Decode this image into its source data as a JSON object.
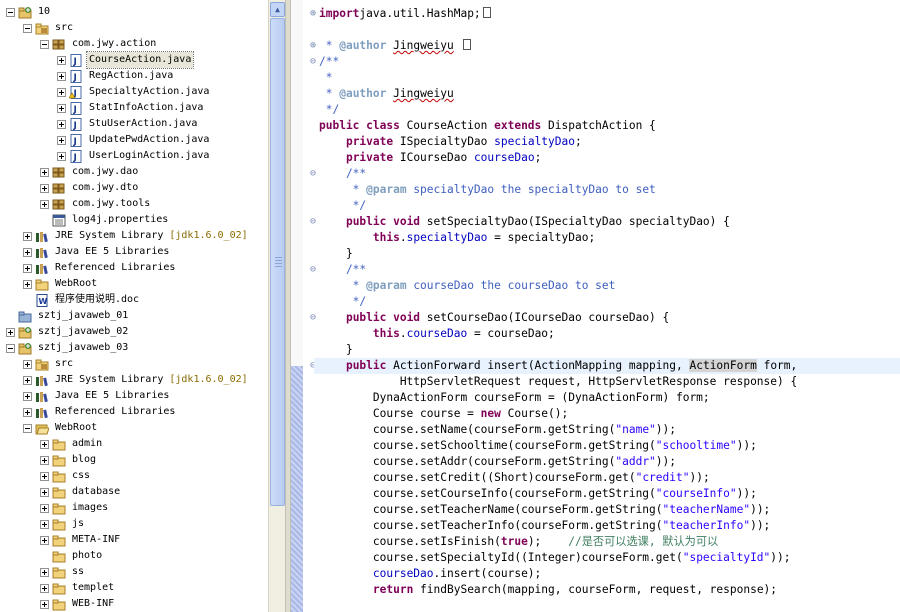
{
  "explorer": {
    "rows": [
      {
        "id": "r0",
        "indent": 0,
        "toggle": "minus",
        "icon": "project-icon",
        "label": "10"
      },
      {
        "id": "r1",
        "indent": 1,
        "toggle": "minus",
        "icon": "source-folder-icon",
        "label": "src"
      },
      {
        "id": "r2",
        "indent": 2,
        "toggle": "minus",
        "icon": "package-icon",
        "label": "com.jwy.action"
      },
      {
        "id": "r3",
        "indent": 3,
        "toggle": "plus",
        "icon": "java-file-icon",
        "label": "CourseAction.java",
        "selected": true
      },
      {
        "id": "r4",
        "indent": 3,
        "toggle": "plus",
        "icon": "java-file-icon",
        "label": "RegAction.java"
      },
      {
        "id": "r5",
        "indent": 3,
        "toggle": "plus",
        "icon": "java-file-warning-icon",
        "label": "SpecialtyAction.java"
      },
      {
        "id": "r6",
        "indent": 3,
        "toggle": "plus",
        "icon": "java-file-icon",
        "label": "StatInfoAction.java"
      },
      {
        "id": "r7",
        "indent": 3,
        "toggle": "plus",
        "icon": "java-file-icon",
        "label": "StuUserAction.java"
      },
      {
        "id": "r8",
        "indent": 3,
        "toggle": "plus",
        "icon": "java-file-icon",
        "label": "UpdatePwdAction.java"
      },
      {
        "id": "r9",
        "indent": 3,
        "toggle": "plus",
        "icon": "java-file-icon",
        "label": "UserLoginAction.java"
      },
      {
        "id": "r10",
        "indent": 2,
        "toggle": "plus",
        "icon": "package-icon",
        "label": "com.jwy.dao"
      },
      {
        "id": "r11",
        "indent": 2,
        "toggle": "plus",
        "icon": "package-icon",
        "label": "com.jwy.dto"
      },
      {
        "id": "r12",
        "indent": 2,
        "toggle": "plus",
        "icon": "package-icon",
        "label": "com.jwy.tools"
      },
      {
        "id": "r13",
        "indent": 2,
        "toggle": "none",
        "icon": "properties-file-icon",
        "label": "log4j.properties"
      },
      {
        "id": "r14",
        "indent": 1,
        "toggle": "plus",
        "icon": "library-icon",
        "label": "JRE System Library",
        "deco": "[jdk1.6.0_02]"
      },
      {
        "id": "r15",
        "indent": 1,
        "toggle": "plus",
        "icon": "library-icon",
        "label": "Java EE 5 Libraries"
      },
      {
        "id": "r16",
        "indent": 1,
        "toggle": "plus",
        "icon": "library-icon",
        "label": "Referenced Libraries"
      },
      {
        "id": "r17",
        "indent": 1,
        "toggle": "plus",
        "icon": "folder-icon",
        "label": "WebRoot"
      },
      {
        "id": "r18",
        "indent": 1,
        "toggle": "none",
        "icon": "doc-file-icon",
        "label": "程序使用说明.doc"
      },
      {
        "id": "r19",
        "indent": 0,
        "toggle": "none",
        "icon": "project-closed-icon",
        "label": "sztj_javaweb_01"
      },
      {
        "id": "r20",
        "indent": 0,
        "toggle": "plus",
        "icon": "project-icon",
        "label": "sztj_javaweb_02"
      },
      {
        "id": "r21",
        "indent": 0,
        "toggle": "minus",
        "icon": "project-icon",
        "label": "sztj_javaweb_03"
      },
      {
        "id": "r22",
        "indent": 1,
        "toggle": "plus",
        "icon": "source-folder-icon",
        "label": "src"
      },
      {
        "id": "r23",
        "indent": 1,
        "toggle": "plus",
        "icon": "library-icon",
        "label": "JRE System Library",
        "deco": "[jdk1.6.0_02]"
      },
      {
        "id": "r24",
        "indent": 1,
        "toggle": "plus",
        "icon": "library-icon",
        "label": "Java EE 5 Libraries"
      },
      {
        "id": "r25",
        "indent": 1,
        "toggle": "plus",
        "icon": "library-icon",
        "label": "Referenced Libraries"
      },
      {
        "id": "r26",
        "indent": 1,
        "toggle": "minus",
        "icon": "folder-open-icon",
        "label": "WebRoot"
      },
      {
        "id": "r27",
        "indent": 2,
        "toggle": "plus",
        "icon": "folder-icon",
        "label": "admin"
      },
      {
        "id": "r28",
        "indent": 2,
        "toggle": "plus",
        "icon": "folder-icon",
        "label": "blog"
      },
      {
        "id": "r29",
        "indent": 2,
        "toggle": "plus",
        "icon": "folder-icon",
        "label": "css"
      },
      {
        "id": "r30",
        "indent": 2,
        "toggle": "plus",
        "icon": "folder-icon",
        "label": "database"
      },
      {
        "id": "r31",
        "indent": 2,
        "toggle": "plus",
        "icon": "folder-icon",
        "label": "images"
      },
      {
        "id": "r32",
        "indent": 2,
        "toggle": "plus",
        "icon": "folder-icon",
        "label": "js"
      },
      {
        "id": "r33",
        "indent": 2,
        "toggle": "plus",
        "icon": "folder-icon",
        "label": "META-INF"
      },
      {
        "id": "r34",
        "indent": 2,
        "toggle": "none",
        "icon": "folder-icon",
        "label": "photo"
      },
      {
        "id": "r35",
        "indent": 2,
        "toggle": "plus",
        "icon": "folder-icon",
        "label": "ss"
      },
      {
        "id": "r36",
        "indent": 2,
        "toggle": "plus",
        "icon": "folder-icon",
        "label": "templet"
      },
      {
        "id": "r37",
        "indent": 2,
        "toggle": "plus",
        "icon": "folder-icon",
        "label": "WEB-INF"
      }
    ],
    "scroll_up_icon": "scroll-up-arrow-icon"
  },
  "editor": {
    "lines": [
      {
        "fold": "plus",
        "tokens": [
          [
            "k",
            "import"
          ],
          [
            "",
            "java.util.HashMap;"
          ],
          [
            "box",
            ""
          ]
        ]
      },
      {
        "fold": "",
        "tokens": []
      },
      {
        "fold": "plus",
        "tokens": [
          [
            "cm",
            " * "
          ],
          [
            "tag",
            "@author"
          ],
          [
            "cm",
            " "
          ],
          [
            "sq",
            "Jingweiyu"
          ],
          [
            "cm",
            " "
          ],
          [
            "box",
            ""
          ]
        ]
      },
      {
        "fold": "minus",
        "tokens": [
          [
            "cm",
            "/**"
          ]
        ]
      },
      {
        "fold": "",
        "tokens": [
          [
            "cm",
            " *"
          ]
        ]
      },
      {
        "fold": "",
        "tokens": [
          [
            "cm",
            " * "
          ],
          [
            "tag",
            "@author"
          ],
          [
            "cm",
            " "
          ],
          [
            "sq",
            "Jingweiyu"
          ]
        ]
      },
      {
        "fold": "",
        "tokens": [
          [
            "cm",
            " */"
          ]
        ]
      },
      {
        "fold": "",
        "tokens": [
          [
            "k",
            "public class"
          ],
          [
            "",
            " CourseAction "
          ],
          [
            "k",
            "extends"
          ],
          [
            "",
            " DispatchAction {"
          ]
        ]
      },
      {
        "fold": "",
        "tokens": [
          [
            "",
            "    "
          ],
          [
            "k",
            "private"
          ],
          [
            "",
            " ISpecialtyDao "
          ],
          [
            "f",
            "specialtyDao"
          ],
          [
            "",
            ";"
          ]
        ]
      },
      {
        "fold": "",
        "tokens": [
          [
            "",
            "    "
          ],
          [
            "k",
            "private"
          ],
          [
            "",
            " ICourseDao "
          ],
          [
            "f",
            "courseDao"
          ],
          [
            "",
            ";"
          ]
        ]
      },
      {
        "fold": "minus",
        "tokens": [
          [
            "cm",
            "    /**"
          ]
        ]
      },
      {
        "fold": "",
        "tokens": [
          [
            "cm",
            "     * "
          ],
          [
            "tag",
            "@param"
          ],
          [
            "cm",
            " specialtyDao the specialtyDao to set"
          ]
        ]
      },
      {
        "fold": "",
        "tokens": [
          [
            "cm",
            "     */"
          ]
        ]
      },
      {
        "fold": "minus",
        "tokens": [
          [
            "",
            "    "
          ],
          [
            "k",
            "public void"
          ],
          [
            "",
            " setSpecialtyDao(ISpecialtyDao specialtyDao) {"
          ]
        ]
      },
      {
        "fold": "",
        "tokens": [
          [
            "",
            "        "
          ],
          [
            "k",
            "this"
          ],
          [
            "",
            "."
          ],
          [
            "f",
            "specialtyDao"
          ],
          [
            "",
            " = specialtyDao;"
          ]
        ]
      },
      {
        "fold": "",
        "tokens": [
          [
            "",
            "    }"
          ]
        ]
      },
      {
        "fold": "minus",
        "tokens": [
          [
            "cm",
            "    /**"
          ]
        ]
      },
      {
        "fold": "",
        "tokens": [
          [
            "cm",
            "     * "
          ],
          [
            "tag",
            "@param"
          ],
          [
            "cm",
            " courseDao the courseDao to set"
          ]
        ]
      },
      {
        "fold": "",
        "tokens": [
          [
            "cm",
            "     */"
          ]
        ]
      },
      {
        "fold": "minus",
        "tokens": [
          [
            "",
            "    "
          ],
          [
            "k",
            "public void"
          ],
          [
            "",
            " setCourseDao(ICourseDao courseDao) {"
          ]
        ]
      },
      {
        "fold": "",
        "tokens": [
          [
            "",
            "        "
          ],
          [
            "k",
            "this"
          ],
          [
            "",
            "."
          ],
          [
            "f",
            "courseDao"
          ],
          [
            "",
            " = courseDao;"
          ]
        ]
      },
      {
        "fold": "",
        "tokens": [
          [
            "",
            "    }"
          ]
        ]
      },
      {
        "fold": "minus",
        "current": true,
        "tokens": [
          [
            "",
            "    "
          ],
          [
            "k",
            "public"
          ],
          [
            "",
            " ActionForward insert(ActionMapping mapping, "
          ],
          [
            "hl",
            "ActionForm"
          ],
          [
            "",
            " form,"
          ]
        ]
      },
      {
        "fold": "",
        "tokens": [
          [
            "",
            "            HttpServletRequest request, HttpServletResponse response) {"
          ]
        ]
      },
      {
        "fold": "",
        "tokens": [
          [
            "",
            "        DynaActionForm courseForm = (DynaActionForm) form;"
          ]
        ]
      },
      {
        "fold": "",
        "tokens": [
          [
            "",
            "        Course course = "
          ],
          [
            "k",
            "new"
          ],
          [
            "",
            " Course();"
          ]
        ]
      },
      {
        "fold": "",
        "tokens": [
          [
            "",
            "        course.setName(courseForm.getString("
          ],
          [
            "s",
            "\"name\""
          ],
          [
            "",
            "));"
          ]
        ]
      },
      {
        "fold": "",
        "tokens": [
          [
            "",
            "        course.setSchooltime(courseForm.getString("
          ],
          [
            "s",
            "\"schooltime\""
          ],
          [
            "",
            "));"
          ]
        ]
      },
      {
        "fold": "",
        "tokens": [
          [
            "",
            "        course.setAddr(courseForm.getString("
          ],
          [
            "s",
            "\"addr\""
          ],
          [
            "",
            "));"
          ]
        ]
      },
      {
        "fold": "",
        "tokens": [
          [
            "",
            "        course.setCredit((Short)courseForm.get("
          ],
          [
            "s",
            "\"credit\""
          ],
          [
            "",
            "));"
          ]
        ]
      },
      {
        "fold": "",
        "tokens": [
          [
            "",
            "        course.setCourseInfo(courseForm.getString("
          ],
          [
            "s",
            "\"courseInfo\""
          ],
          [
            "",
            "));"
          ]
        ]
      },
      {
        "fold": "",
        "tokens": [
          [
            "",
            "        course.setTeacherName(courseForm.getString("
          ],
          [
            "s",
            "\"teacherName\""
          ],
          [
            "",
            "));"
          ]
        ]
      },
      {
        "fold": "",
        "tokens": [
          [
            "",
            "        course.setTeacherInfo(courseForm.getString("
          ],
          [
            "s",
            "\"teacherInfo\""
          ],
          [
            "",
            "));"
          ]
        ]
      },
      {
        "fold": "",
        "tokens": [
          [
            "",
            "        course.setIsFinish("
          ],
          [
            "k",
            "true"
          ],
          [
            "",
            ");    "
          ],
          [
            "lc",
            "//是否可以选课, 默认为可以"
          ]
        ]
      },
      {
        "fold": "",
        "tokens": [
          [
            "",
            "        course.setSpecialtyId((Integer)courseForm.get("
          ],
          [
            "s",
            "\"specialtyId\""
          ],
          [
            "",
            "));"
          ]
        ]
      },
      {
        "fold": "",
        "tokens": [
          [
            "",
            "        "
          ],
          [
            "f",
            "courseDao"
          ],
          [
            "",
            ".insert(course);"
          ]
        ]
      },
      {
        "fold": "",
        "tokens": [
          [
            "",
            "        "
          ],
          [
            "k",
            "return"
          ],
          [
            "",
            " findBySearch(mapping, courseForm, request, response);"
          ]
        ]
      }
    ]
  },
  "colors": {
    "keyword": "#7f0055",
    "field": "#0000c0",
    "string": "#2a00ff",
    "javadoc": "#3f5fbf",
    "line_comment": "#3f7f5f",
    "current_line": "#e8f2fe"
  }
}
